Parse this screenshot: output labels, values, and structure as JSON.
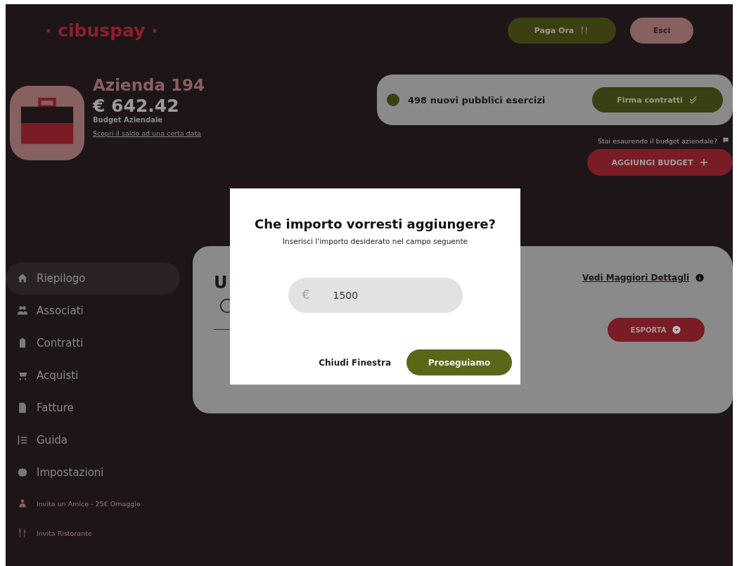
{
  "header": {
    "logo": "· cibuspay ·",
    "buttons": [
      {
        "label": "Paga Ora",
        "kind": "pay"
      },
      {
        "label": "Esci",
        "kind": "logout"
      }
    ]
  },
  "company": {
    "name": "Azienda 194",
    "balance": "€ 642.42",
    "balance_label": "Budget Aziendale",
    "link": "Scopri il saldo ad una certa data"
  },
  "notice": {
    "text": "498 nuovi pubblici esercizi",
    "color": "#3a4012",
    "button": "Firma contratti"
  },
  "budget_hint": "Stai esaurendo il budget aziendale?",
  "add_budget_button": "AGGIUNGI BUDGET",
  "sidebar": {
    "items": [
      {
        "label": "Riepilogo",
        "kind": "main",
        "selected": true
      },
      {
        "label": "Associati",
        "kind": "main",
        "selected": false
      },
      {
        "label": "Contratti",
        "kind": "main",
        "selected": false
      },
      {
        "label": "Acquisti",
        "kind": "main",
        "selected": false
      },
      {
        "label": "Fatture",
        "kind": "main",
        "selected": false
      },
      {
        "label": "Guida",
        "kind": "main",
        "selected": false
      },
      {
        "label": "Impostazioni",
        "kind": "main",
        "selected": false
      },
      {
        "label": "Invita un Amico - 25€ Omaggio",
        "kind": "small",
        "selected": false
      },
      {
        "label": "Invita Ristorante",
        "kind": "small",
        "selected": false
      }
    ]
  },
  "card": {
    "title": "U",
    "details_link": "Vedi Maggiori Dettagli",
    "export_button": "ESPORTA"
  },
  "modal": {
    "title": "Che importo vorresti aggiungere?",
    "subtitle": "Inserisci l'importo desiderato nel campo seguente",
    "currency": "€",
    "amount": "1500",
    "close_button": "Chiudi Finestra",
    "confirm_button": "Proseguiamo"
  }
}
